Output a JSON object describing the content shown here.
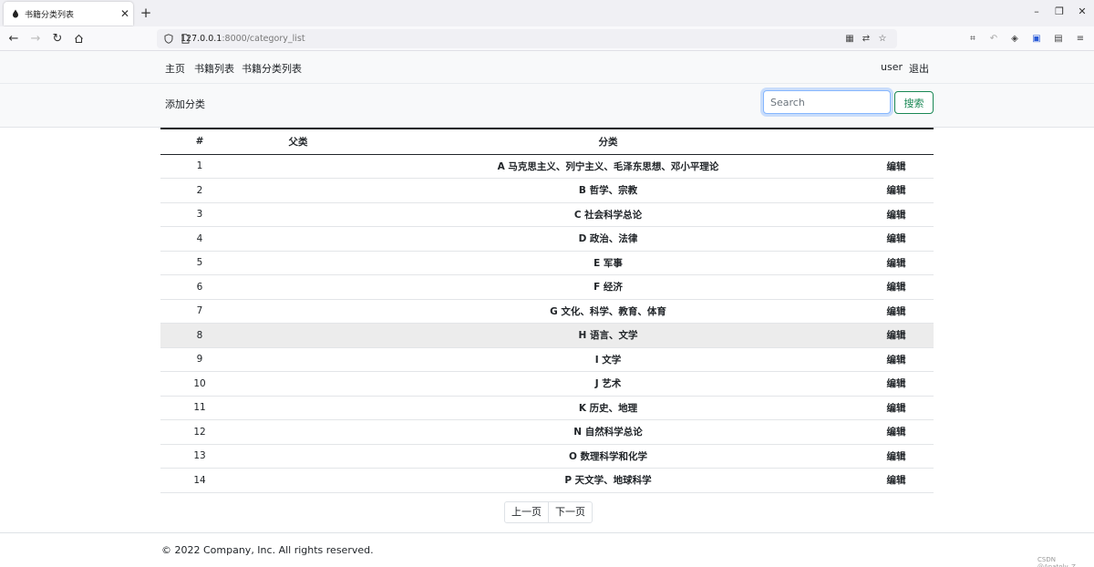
{
  "browser": {
    "tab_title": "书籍分类列表",
    "url_host": "127.0.0.1",
    "url_path": ":8000/category_list"
  },
  "nav": {
    "home": "主页",
    "book_list": "书籍列表",
    "category_list": "书籍分类列表",
    "user": "user",
    "logout": "退出"
  },
  "toolbar": {
    "add_category": "添加分类",
    "search_placeholder": "Search",
    "search_button": "搜索"
  },
  "table": {
    "headers": [
      "#",
      "父类",
      "分类",
      ""
    ],
    "edit_label": "编辑",
    "rows": [
      {
        "num": "1",
        "parent": "",
        "category": "A 马克思主义、列宁主义、毛泽东思想、邓小平理论"
      },
      {
        "num": "2",
        "parent": "",
        "category": "B 哲学、宗教"
      },
      {
        "num": "3",
        "parent": "",
        "category": "C 社会科学总论"
      },
      {
        "num": "4",
        "parent": "",
        "category": "D 政治、法律"
      },
      {
        "num": "5",
        "parent": "",
        "category": "E 军事"
      },
      {
        "num": "6",
        "parent": "",
        "category": "F 经济"
      },
      {
        "num": "7",
        "parent": "",
        "category": "G 文化、科学、教育、体育"
      },
      {
        "num": "8",
        "parent": "",
        "category": "H 语言、文学"
      },
      {
        "num": "9",
        "parent": "",
        "category": "I 文学"
      },
      {
        "num": "10",
        "parent": "",
        "category": "J 艺术"
      },
      {
        "num": "11",
        "parent": "",
        "category": "K 历史、地理"
      },
      {
        "num": "12",
        "parent": "",
        "category": "N 自然科学总论"
      },
      {
        "num": "13",
        "parent": "",
        "category": "O 数理科学和化学"
      },
      {
        "num": "14",
        "parent": "",
        "category": "P 天文学、地球科学"
      }
    ]
  },
  "pagination": {
    "prev": "上一页",
    "next": "下一页"
  },
  "footer": {
    "copyright": "© 2022 Company, Inc. All rights reserved."
  },
  "watermark": "CSDN @Anatoly_Z"
}
